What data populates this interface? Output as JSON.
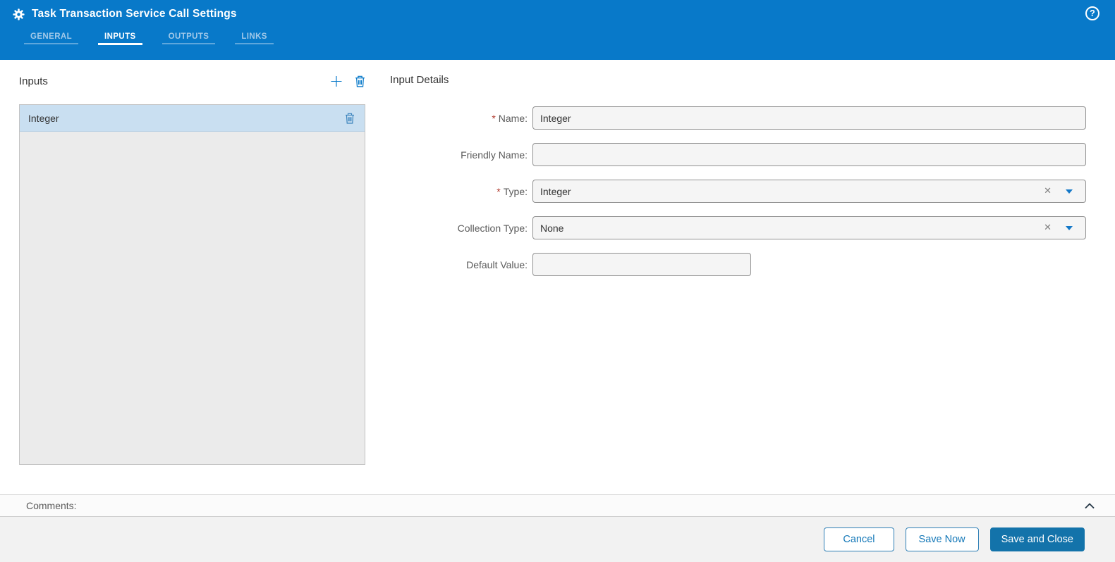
{
  "header": {
    "title": "Task Transaction Service Call Settings",
    "tabs": [
      {
        "label": "GENERAL"
      },
      {
        "label": "INPUTS"
      },
      {
        "label": "OUTPUTS"
      },
      {
        "label": "LINKS"
      }
    ],
    "help_icon_glyph": "?"
  },
  "icons": {
    "gear": "gear-icon",
    "add_glyph": "+",
    "clear_glyph": "✕"
  },
  "symbols": {
    "required": "*"
  },
  "inputs_panel": {
    "title": "Inputs",
    "items": [
      {
        "label": "Integer",
        "selected": true
      }
    ]
  },
  "details": {
    "title": "Input Details",
    "name": {
      "label": "Name:",
      "required": true,
      "value": "Integer"
    },
    "friendly_name": {
      "label": "Friendly Name:",
      "required": false,
      "value": ""
    },
    "type": {
      "label": "Type:",
      "required": true,
      "value": "Integer"
    },
    "collection_type": {
      "label": "Collection Type:",
      "required": false,
      "value": "None"
    },
    "default_value": {
      "label": "Default Value:",
      "required": false,
      "value": ""
    }
  },
  "comments": {
    "label": "Comments:"
  },
  "footer": {
    "cancel_label": "Cancel",
    "save_now_label": "Save Now",
    "save_and_close_label": "Save and Close"
  },
  "colors": {
    "header_blue": "#0879c9",
    "accent_blue": "#1478b8",
    "primary_button_blue": "#1373aa",
    "selected_row_blue": "#c9dff1",
    "required_red": "#b03a2e"
  }
}
